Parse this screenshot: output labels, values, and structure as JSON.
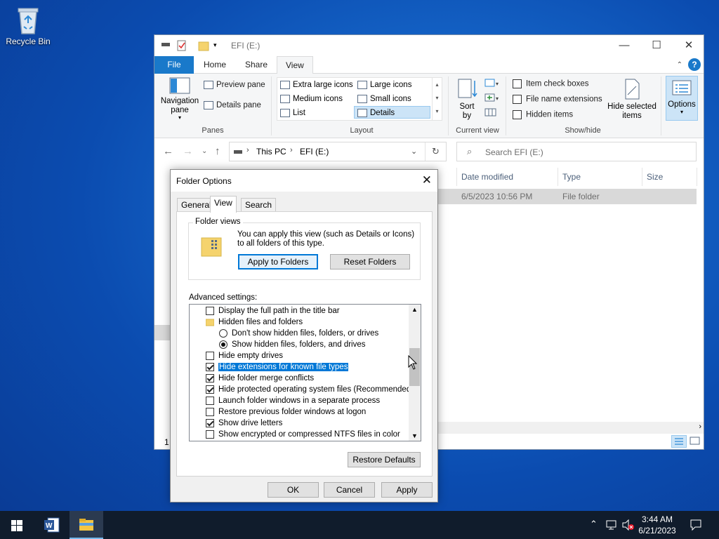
{
  "desktop": {
    "recycle_bin_label": "Recycle Bin"
  },
  "explorer": {
    "title": "EFI (E:)",
    "controls": {
      "minimize": "—",
      "maximize": "☐",
      "close": "✕"
    },
    "ribbon_tabs": [
      "File",
      "Home",
      "Share",
      "View"
    ],
    "active_tab": "View",
    "panes_group": {
      "label": "Panes",
      "navigation_pane": "Navigation pane",
      "preview_pane": "Preview pane",
      "details_pane": "Details pane"
    },
    "layout_group": {
      "label": "Layout",
      "options": [
        "Extra large icons",
        "Large icons",
        "Medium icons",
        "Small icons",
        "List",
        "Details"
      ],
      "selected": "Details"
    },
    "current_view_group": {
      "label": "Current view",
      "sort_by": "Sort by"
    },
    "showhide_group": {
      "label": "Show/hide",
      "item_check_boxes": {
        "label": "Item check boxes",
        "checked": false
      },
      "file_name_extensions": {
        "label": "File name extensions",
        "checked": false
      },
      "hidden_items": {
        "label": "Hidden items",
        "checked": false
      },
      "hide_selected_items": "Hide selected items"
    },
    "options_label": "Options",
    "address": {
      "this_pc": "This PC",
      "drive": "EFI (E:)"
    },
    "search_placeholder": "Search EFI (E:)",
    "columns": {
      "date_modified": "Date modified",
      "type": "Type",
      "size": "Size"
    },
    "file_row": {
      "date": "6/5/2023 10:56 PM",
      "type": "File folder"
    },
    "status_count": "1"
  },
  "folder_options": {
    "title": "Folder Options",
    "tabs": [
      "General",
      "View",
      "Search"
    ],
    "active_tab": "View",
    "folder_views": {
      "legend": "Folder views",
      "description": "You can apply this view (such as Details or Icons) to all folders of this type.",
      "apply_button": "Apply to Folders",
      "reset_button": "Reset Folders"
    },
    "advanced_label": "Advanced settings:",
    "advanced_items": [
      {
        "kind": "checkbox",
        "label": "Display the full path in the title bar",
        "checked": false,
        "indent": 1
      },
      {
        "kind": "folder",
        "label": "Hidden files and folders",
        "indent": 1
      },
      {
        "kind": "radio",
        "label": "Don't show hidden files, folders, or drives",
        "checked": false,
        "indent": 2
      },
      {
        "kind": "radio",
        "label": "Show hidden files, folders, and drives",
        "checked": true,
        "indent": 2
      },
      {
        "kind": "checkbox",
        "label": "Hide empty drives",
        "checked": false,
        "indent": 1
      },
      {
        "kind": "checkbox",
        "label": "Hide extensions for known file types",
        "checked": true,
        "indent": 1,
        "highlighted": true
      },
      {
        "kind": "checkbox",
        "label": "Hide folder merge conflicts",
        "checked": true,
        "indent": 1
      },
      {
        "kind": "checkbox",
        "label": "Hide protected operating system files (Recommended)",
        "checked": true,
        "indent": 1
      },
      {
        "kind": "checkbox",
        "label": "Launch folder windows in a separate process",
        "checked": false,
        "indent": 1
      },
      {
        "kind": "checkbox",
        "label": "Restore previous folder windows at logon",
        "checked": false,
        "indent": 1
      },
      {
        "kind": "checkbox",
        "label": "Show drive letters",
        "checked": true,
        "indent": 1
      },
      {
        "kind": "checkbox",
        "label": "Show encrypted or compressed NTFS files in color",
        "checked": false,
        "indent": 1
      }
    ],
    "scroll_position": 0.42,
    "restore_defaults": "Restore Defaults",
    "ok": "OK",
    "cancel": "Cancel",
    "apply": "Apply"
  },
  "taskbar": {
    "apps": [
      "start-icon",
      "word-icon",
      "file-explorer-icon"
    ],
    "time": "3:44 AM",
    "date": "6/21/2023"
  },
  "colors": {
    "accent": "#0078d7",
    "file_tab": "#1979ca",
    "taskbar": "#101c2c"
  }
}
